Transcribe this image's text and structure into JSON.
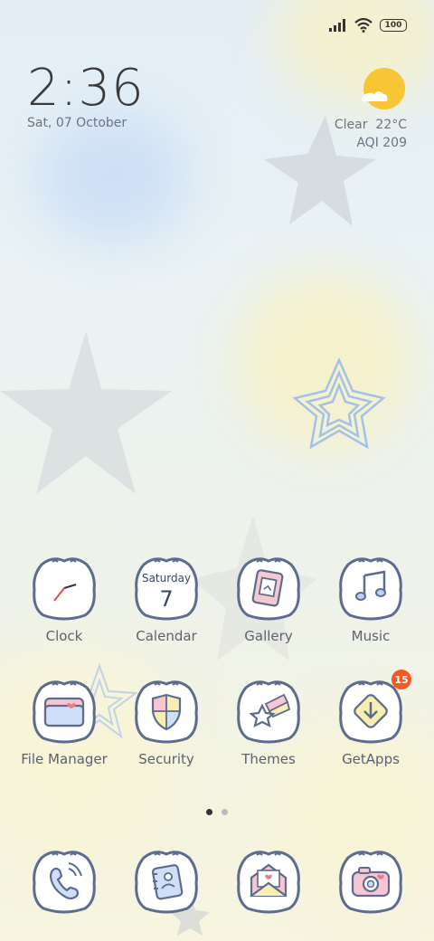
{
  "status_bar": {
    "battery_level": "100",
    "signal_icon": "signal-icon",
    "wifi_icon": "wifi-icon"
  },
  "clock_widget": {
    "time": "2:36",
    "date": "Sat, 07 October"
  },
  "weather_widget": {
    "condition": "Clear",
    "temperature": "22°C",
    "aqi": "AQI 209",
    "icon": "sun-cloud-icon"
  },
  "home_apps": [
    {
      "label": "Clock",
      "icon": "clock-icon"
    },
    {
      "label": "Calendar",
      "icon": "calendar-icon",
      "icon_day": "Saturday",
      "icon_date": "7"
    },
    {
      "label": "Gallery",
      "icon": "gallery-icon"
    },
    {
      "label": "Music",
      "icon": "music-icon"
    },
    {
      "label": "File Manager",
      "icon": "folder-icon"
    },
    {
      "label": "Security",
      "icon": "shield-icon"
    },
    {
      "label": "Themes",
      "icon": "themes-star-icon"
    },
    {
      "label": "GetApps",
      "icon": "getapps-icon",
      "badge": "15"
    }
  ],
  "dock_apps": [
    {
      "icon": "phone-icon"
    },
    {
      "icon": "contacts-notebook-icon"
    },
    {
      "icon": "messages-envelope-icon"
    },
    {
      "icon": "camera-icon"
    }
  ],
  "page_indicator": {
    "pages": 2,
    "current": 1
  },
  "colors": {
    "icon_outline": "#5d6b8e",
    "icon_fill": "#ffffff",
    "badge": "#f25a22",
    "text": "#5a6270"
  }
}
